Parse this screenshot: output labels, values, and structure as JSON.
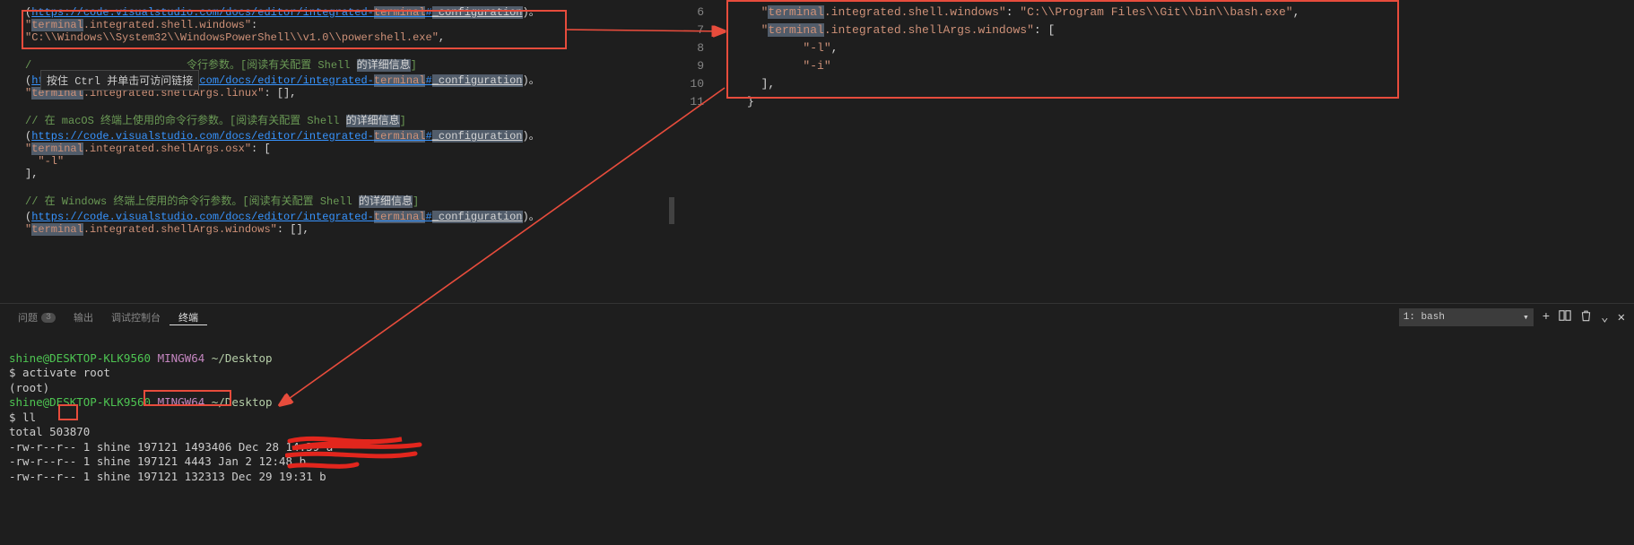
{
  "leftEditor": {
    "url_top": "https://code.visualstudio.com/docs/editor/integrated-terminal#_configuration",
    "setting_win_key": "terminal.integrated.shell.windows",
    "setting_win_val": "C:\\\\Windows\\\\System32\\\\WindowsPowerShell\\\\v1.0\\\\powershell.exe",
    "tooltip": "按住 Ctrl 并单击可访问链接",
    "comment_linux_a": "令行参数。[阅读有关配置 Shell ",
    "comment_linux_b": "的详细信息",
    "url_line2": "https://code.visualstudio.com/docs/editor/integrated-terminal#_configuration",
    "setting_args_linux": "terminal.integrated.shellArgs.linux",
    "comment_mac": "// 在 macOS 终端上使用的命令行参数。[阅读有关配置 Shell ",
    "comment_detail": "的详细信息",
    "url_line3": "https://code.visualstudio.com/docs/editor/integrated-terminal#_configuration",
    "setting_args_osx": "terminal.integrated.shellArgs.osx",
    "arg_l": "-l",
    "comment_win": "// 在 Windows 终端上使用的命令行参数。[阅读有关配置 Shell ",
    "url_line4": "https://code.visualstudio.com/docs/editor/integrated-terminal#_configuration",
    "setting_args_win": "terminal.integrated.shellArgs.windows"
  },
  "rightEditor": {
    "lines": [
      "6",
      "7",
      "8",
      "9",
      "10",
      "11"
    ],
    "shell_key": "terminal.integrated.shell.windows",
    "shell_val": "C:\\\\Program Files\\\\Git\\\\bin\\\\bash.exe",
    "args_key": "terminal.integrated.shellArgs.windows",
    "arg1": "-l",
    "arg2": "-i"
  },
  "panel": {
    "tabs": {
      "problems": "问题",
      "problems_count": "3",
      "output": "输出",
      "debug": "调试控制台",
      "terminal": "终端"
    },
    "select": "1: bash"
  },
  "terminal": {
    "prompt_user": "shine@DESKTOP-KLK9560",
    "mingw": "MINGW64",
    "path": "~/Desktop",
    "cmd1": "$ activate root",
    "root": "(root)",
    "cmd2": "$ ll",
    "total": "total 503870",
    "r1": "-rw-r--r-- 1 shine 197121  1493406 Dec 28 14:39 a",
    "r2": "-rw-r--r-- 1 shine 197121     4443 Jan  2 12:48 b",
    "r3": "-rw-r--r-- 1 shine 197121   132313 Dec 29 19:31 b"
  }
}
